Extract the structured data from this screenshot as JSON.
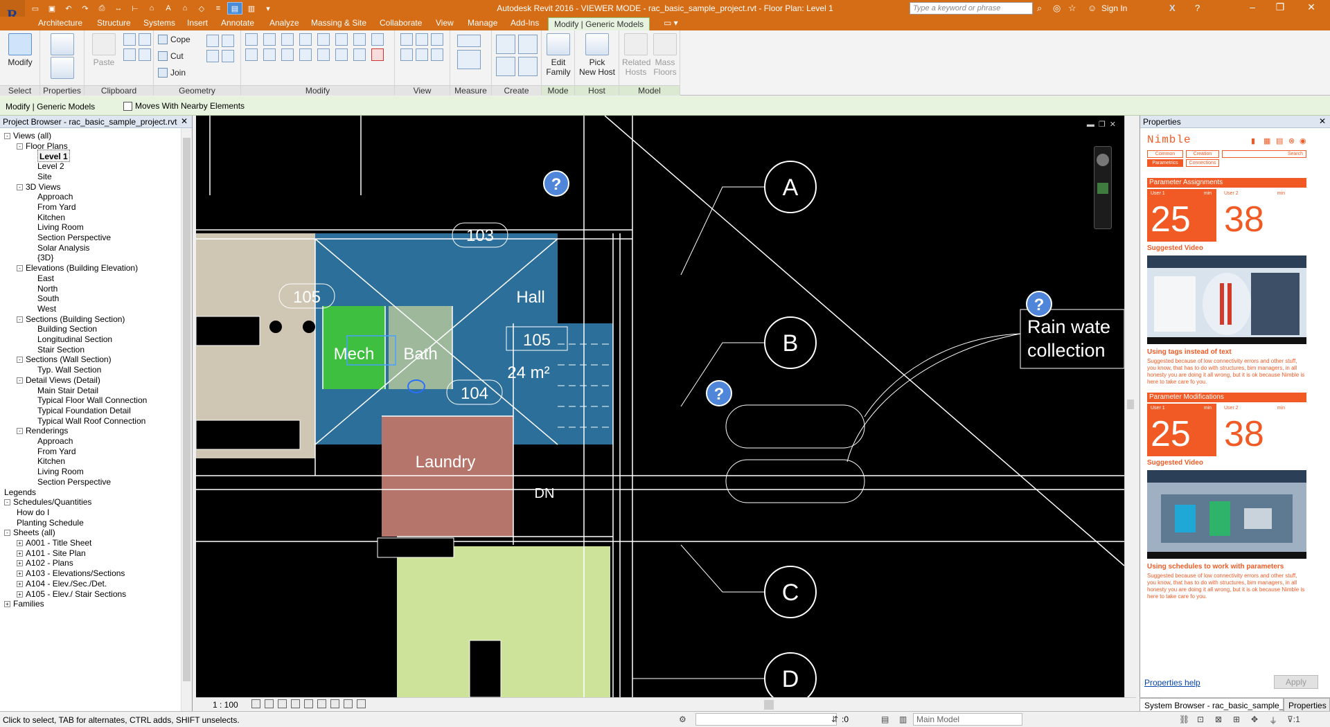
{
  "titlebar": {
    "title": "Autodesk Revit 2016 - VIEWER MODE -      rac_basic_sample_project.rvt - Floor Plan: Level 1",
    "search_placeholder": "Type a keyword or phrase",
    "sign_in": "Sign In"
  },
  "tabs": [
    "Architecture",
    "Structure",
    "Systems",
    "Insert",
    "Annotate",
    "Analyze",
    "Massing & Site",
    "Collaborate",
    "View",
    "Manage",
    "Add-Ins",
    "Modify | Generic Models"
  ],
  "ribbon": {
    "select": {
      "button": "Modify",
      "label": "Select"
    },
    "properties": {
      "label": "Properties"
    },
    "clipboard": {
      "paste": "Paste",
      "label": "Clipboard"
    },
    "geometry": {
      "cope": "Cope",
      "cut": "Cut",
      "join": "Join",
      "label": "Geometry"
    },
    "modify": {
      "label": "Modify"
    },
    "view": {
      "label": "View"
    },
    "measure": {
      "label": "Measure"
    },
    "create": {
      "label": "Create"
    },
    "mode": {
      "edit_family_1": "Edit",
      "edit_family_2": "Family",
      "label": "Mode"
    },
    "host": {
      "pick_1": "Pick",
      "pick_2": "New Host",
      "label": "Host"
    },
    "model": {
      "related_1": "Related",
      "related_2": "Hosts",
      "mass_1": "Mass",
      "mass_2": "Floors",
      "label": "Model"
    }
  },
  "optionsbar": {
    "context": "Modify | Generic Models",
    "checkbox_label": "Moves With Nearby Elements"
  },
  "project_browser": {
    "title": "Project Browser - rac_basic_sample_project.rvt",
    "items": [
      {
        "label": "Views (all)",
        "level": 0,
        "exp": "-"
      },
      {
        "label": "Floor Plans",
        "level": 1,
        "exp": "-"
      },
      {
        "label": "Level 1",
        "level": 2,
        "selected": true
      },
      {
        "label": "Level 2",
        "level": 2
      },
      {
        "label": "Site",
        "level": 2
      },
      {
        "label": "3D Views",
        "level": 1,
        "exp": "-"
      },
      {
        "label": "Approach",
        "level": 2
      },
      {
        "label": "From Yard",
        "level": 2
      },
      {
        "label": "Kitchen",
        "level": 2
      },
      {
        "label": "Living Room",
        "level": 2
      },
      {
        "label": "Section Perspective",
        "level": 2
      },
      {
        "label": "Solar Analysis",
        "level": 2
      },
      {
        "label": "{3D}",
        "level": 2
      },
      {
        "label": "Elevations (Building Elevation)",
        "level": 1,
        "exp": "-"
      },
      {
        "label": "East",
        "level": 2
      },
      {
        "label": "North",
        "level": 2
      },
      {
        "label": "South",
        "level": 2
      },
      {
        "label": "West",
        "level": 2
      },
      {
        "label": "Sections (Building Section)",
        "level": 1,
        "exp": "-"
      },
      {
        "label": "Building Section",
        "level": 2
      },
      {
        "label": "Longitudinal Section",
        "level": 2
      },
      {
        "label": "Stair Section",
        "level": 2
      },
      {
        "label": "Sections (Wall Section)",
        "level": 1,
        "exp": "-"
      },
      {
        "label": "Typ. Wall Section",
        "level": 2
      },
      {
        "label": "Detail Views (Detail)",
        "level": 1,
        "exp": "-"
      },
      {
        "label": "Main Stair Detail",
        "level": 2
      },
      {
        "label": "Typical Floor Wall Connection",
        "level": 2
      },
      {
        "label": "Typical Foundation Detail",
        "level": 2
      },
      {
        "label": "Typical Wall Roof Connection",
        "level": 2
      },
      {
        "label": "Renderings",
        "level": 1,
        "exp": "-"
      },
      {
        "label": "Approach",
        "level": 2
      },
      {
        "label": "From Yard",
        "level": 2
      },
      {
        "label": "Kitchen",
        "level": 2
      },
      {
        "label": "Living Room",
        "level": 2
      },
      {
        "label": "Section Perspective",
        "level": 2
      },
      {
        "label": "Legends",
        "level": 0
      },
      {
        "label": "Schedules/Quantities",
        "level": 0,
        "exp": "-"
      },
      {
        "label": "How do I",
        "level": 1
      },
      {
        "label": "Planting Schedule",
        "level": 1
      },
      {
        "label": "Sheets (all)",
        "level": 0,
        "exp": "-"
      },
      {
        "label": "A001 - Title Sheet",
        "level": 1,
        "exp": "+"
      },
      {
        "label": "A101 - Site Plan",
        "level": 1,
        "exp": "+"
      },
      {
        "label": "A102 - Plans",
        "level": 1,
        "exp": "+"
      },
      {
        "label": "A103 - Elevations/Sections",
        "level": 1,
        "exp": "+"
      },
      {
        "label": "A104 - Elev./Sec./Det.",
        "level": 1,
        "exp": "+"
      },
      {
        "label": "A105 - Elev./ Stair Sections",
        "level": 1,
        "exp": "+"
      },
      {
        "label": "Families",
        "level": 0,
        "exp": "+"
      }
    ]
  },
  "drawing": {
    "rooms": {
      "mech": "Mech",
      "bath": "Bath",
      "hall": "Hall",
      "laundry": "Laundry"
    },
    "tags": {
      "t103": "103",
      "t105a": "105",
      "t105b": "105",
      "t104": "104"
    },
    "area": "24 m²",
    "dn": "DN",
    "grids": {
      "a": "A",
      "b": "B",
      "c": "C",
      "d": "D"
    },
    "note_line1": "Rain wate",
    "note_line2": "collection",
    "q": "?"
  },
  "viewcontrol": {
    "scale": "1 : 100"
  },
  "properties": {
    "title": "Properties",
    "nimble": {
      "logo": "Nimble",
      "tabs": {
        "common": "Common",
        "creation": "Creation",
        "search": "Search",
        "parametrics": "Parametrics",
        "connections": "Connections"
      },
      "assign_title": "Parameter Assignments",
      "mod_title": "Parameter Modifications",
      "user1": "User 1",
      "user2": "User 2",
      "min": "min",
      "v1": "25",
      "v2": "38",
      "v3": "25",
      "v4": "38",
      "sugg": "Suggested Video",
      "tip1_title": "Using tags instead of text",
      "tip2_title": "Using schedules to work with parameters",
      "tip_text": "Suggested because of low connectivity errors and other stuff, you know, that has to do with structures, bim managers, in all honesty you are doing it all wrong, but it is ok because Nimble is here to take care fo you."
    },
    "help": "Properties help",
    "apply": "Apply"
  },
  "panel_tabs": {
    "system_browser": "System Browser - rac_basic_sample_...",
    "properties": "Properties"
  },
  "status": {
    "message": "Click to select, TAB for alternates, CTRL adds, SHIFT unselects.",
    "zero": ":0",
    "model": "Main Model"
  },
  "colors": {
    "accent": "#d56d16",
    "context_tab": "#e7f3df",
    "nimble": "#f15a24",
    "hall": "#2b6f9a",
    "mech": "#3fbf3f",
    "bath": "#9db89a",
    "laundry": "#b5756a",
    "yard": "#cde39a",
    "kitchen": "#cfc6b3"
  }
}
